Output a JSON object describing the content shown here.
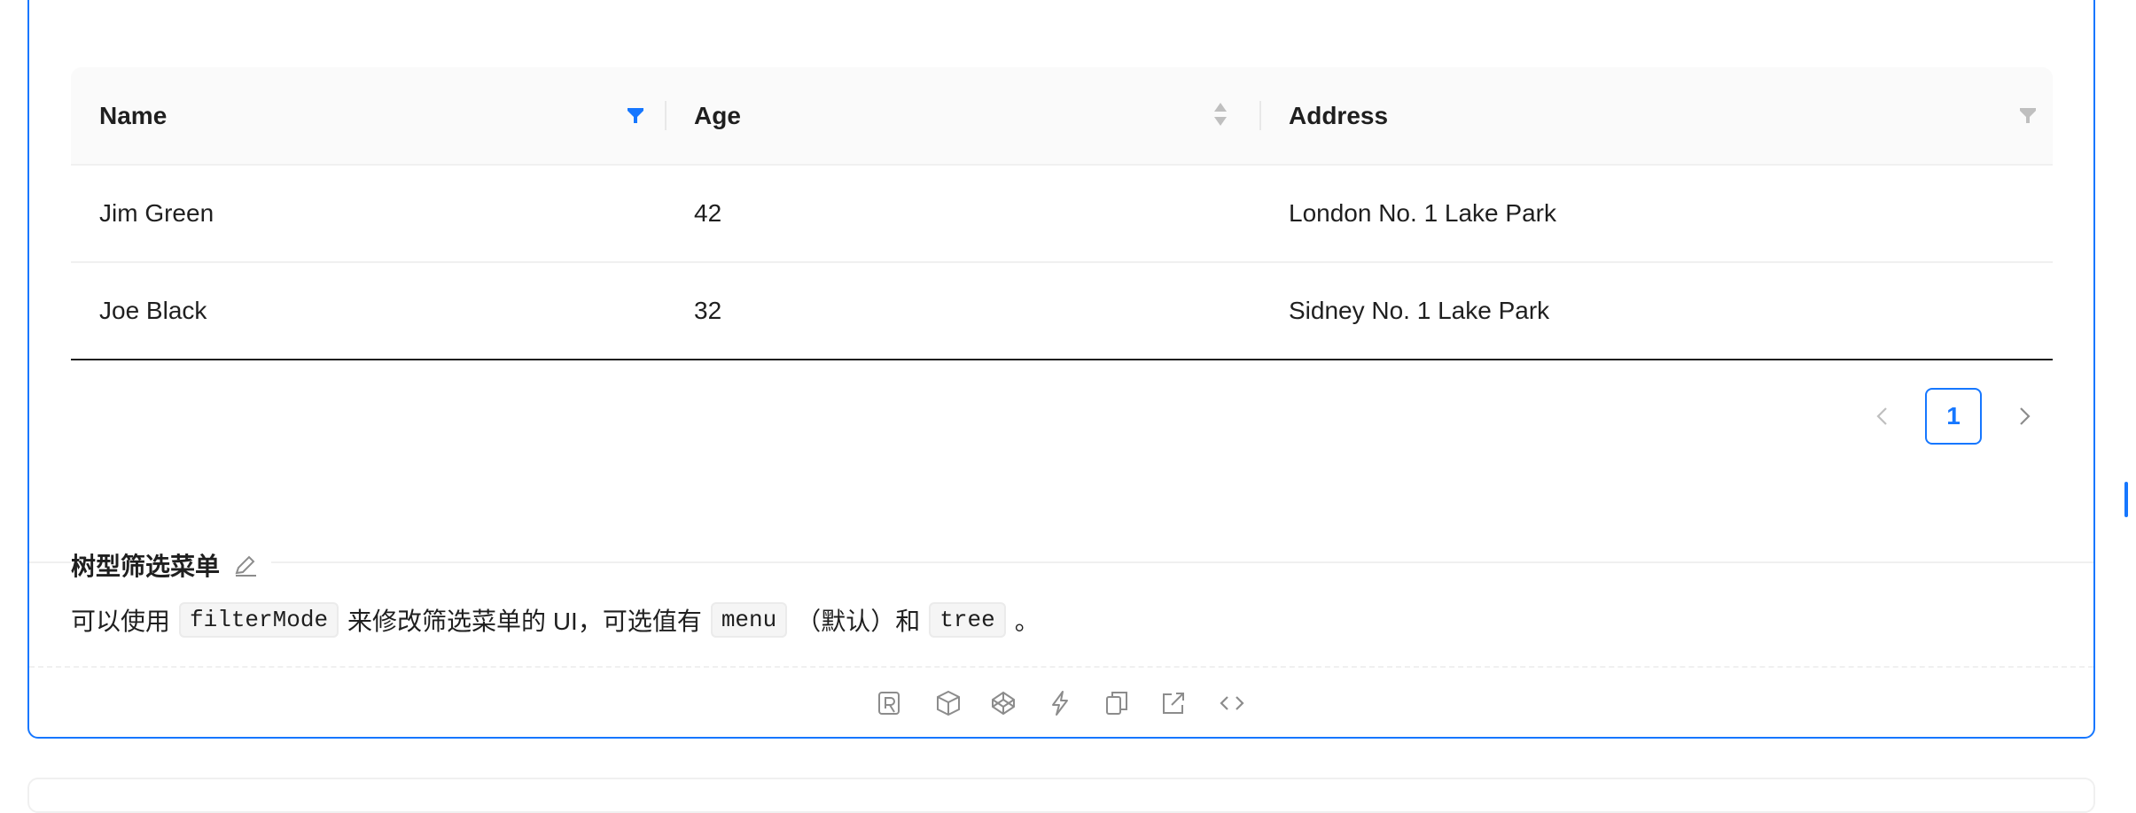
{
  "table": {
    "columns": [
      {
        "label": "Name",
        "control": "filter",
        "filter_active": true
      },
      {
        "label": "Age",
        "control": "sorter"
      },
      {
        "label": "Address",
        "control": "filter",
        "filter_active": false
      }
    ],
    "rows": [
      {
        "name": "Jim Green",
        "age": "42",
        "address": "London No. 1 Lake Park"
      },
      {
        "name": "Joe Black",
        "age": "32",
        "address": "Sidney No. 1 Lake Park"
      }
    ]
  },
  "pagination": {
    "current_page": "1",
    "prev_icon": "chevron-left-icon",
    "next_icon": "chevron-right-icon"
  },
  "section": {
    "title": "树型筛选菜单",
    "edit_icon": "edit-icon",
    "desc_1": "可以使用",
    "code_1": "filterMode",
    "desc_2": "来修改筛选菜单的 UI，可选值有",
    "code_2": "menu",
    "desc_3": "（默认）和",
    "code_3": "tree",
    "desc_4": "。"
  },
  "actions": [
    "ai-icon",
    "sandbox-icon",
    "codepen-icon",
    "stackblitz-icon",
    "copy-icon",
    "open-new-icon",
    "code-icon"
  ],
  "colors": {
    "primary": "#1677ff",
    "header_bg": "#fafafa",
    "border": "#f0f0f0"
  }
}
